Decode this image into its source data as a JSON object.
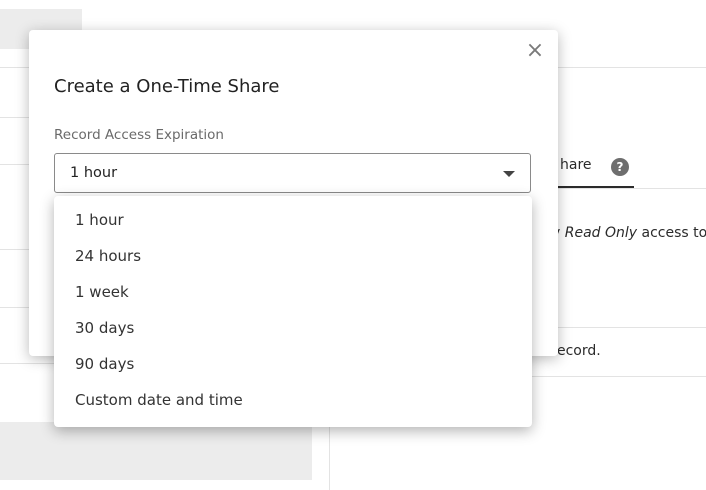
{
  "background": {
    "tab_label": "hare",
    "help_glyph": "?",
    "access_prefix": "y ",
    "access_emphasis": "Read Only",
    "access_suffix": " access to",
    "record_text": "ecord."
  },
  "modal": {
    "title": "Create a One-Time Share",
    "close_glyph": "×",
    "field_label": "Record Access Expiration",
    "selected_value": "1 hour"
  },
  "dropdown": {
    "options": [
      "1 hour",
      "24 hours",
      "1 week",
      "30 days",
      "90 days",
      "Custom date and time"
    ]
  }
}
